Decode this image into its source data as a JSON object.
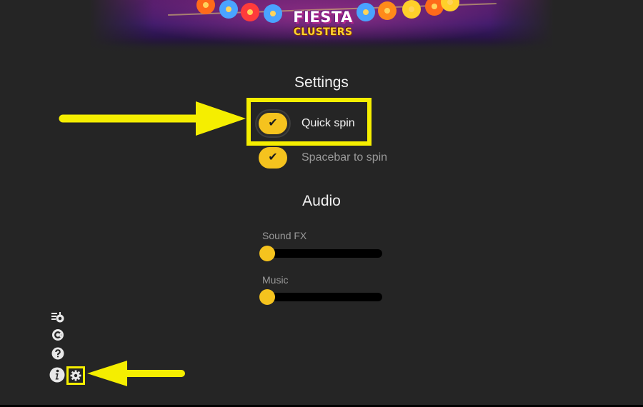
{
  "banner": {
    "logo_line1": "FIESTA",
    "logo_line2": "CLUSTERS"
  },
  "settings": {
    "heading": "Settings",
    "toggles": [
      {
        "label": "Quick spin",
        "checked": true,
        "check_glyph": "✔"
      },
      {
        "label": "Spacebar to spin",
        "checked": true,
        "check_glyph": "✔"
      }
    ]
  },
  "audio": {
    "heading": "Audio",
    "sliders": [
      {
        "label": "Sound FX",
        "level": 0
      },
      {
        "label": "Music",
        "level": 0
      }
    ]
  },
  "side_icons": [
    {
      "icon": "paytable-icon"
    },
    {
      "icon": "at-icon"
    },
    {
      "icon": "help-icon"
    },
    {
      "icon": "info-icon"
    },
    {
      "icon": "gear-icon",
      "highlighted": true
    }
  ],
  "colors": {
    "accent": "#f5c31e",
    "background": "#252525",
    "annotation": "#f5ee00"
  }
}
